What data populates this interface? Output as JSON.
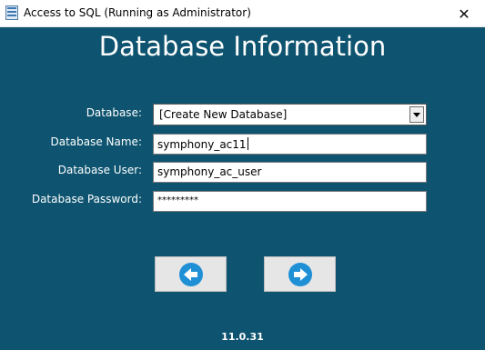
{
  "window": {
    "title": "Access to SQL (Running as Administrator)",
    "close_glyph": "✕",
    "icon": "database-app-icon"
  },
  "heading": "Database Information",
  "form": {
    "database_label": "Database:",
    "database_value": "[Create New Database]",
    "database_name_label": "Database Name:",
    "database_name_value": "symphony_ac11",
    "database_user_label": "Database User:",
    "database_user_value": "symphony_ac_user",
    "database_password_label": "Database Password:",
    "database_password_value": "*********"
  },
  "buttons": {
    "back_icon": "arrow-left-icon",
    "next_icon": "arrow-right-icon"
  },
  "version": "11.0.31",
  "colors": {
    "background": "#0e5470",
    "button_icon": "#1f8fd6"
  }
}
